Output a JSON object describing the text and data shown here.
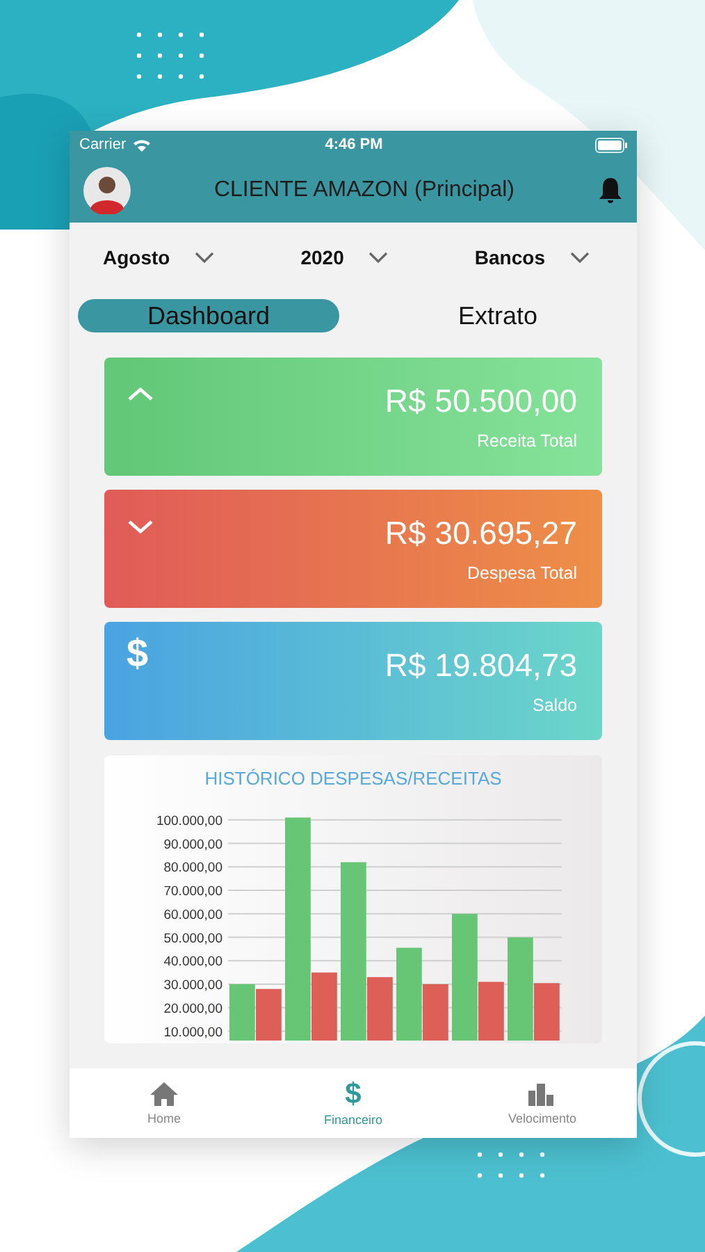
{
  "status_bar": {
    "carrier": "Carrier",
    "time": "4:46 PM"
  },
  "header": {
    "title": "CLIENTE AMAZON (Principal)"
  },
  "filters": [
    {
      "label": "Agosto"
    },
    {
      "label": "2020"
    },
    {
      "label": "Bancos"
    }
  ],
  "tabs": [
    {
      "label": "Dashboard",
      "selected": true
    },
    {
      "label": "Extrato",
      "selected": false
    }
  ],
  "cards": [
    {
      "kind": "income",
      "amount": "R$ 50.500,00",
      "label": "Receita Total"
    },
    {
      "kind": "expense",
      "amount": "R$ 30.695,27",
      "label": "Despesa Total"
    },
    {
      "kind": "balance",
      "icon": "$",
      "amount": "R$ 19.804,73",
      "label": "Saldo"
    }
  ],
  "chart": {
    "chart_data": {
      "type": "bar",
      "title": "HISTÓRICO DESPESAS/RECEITAS",
      "grid": true,
      "stacked": false,
      "ylim": [
        6000,
        102000
      ],
      "yticks": [
        {
          "value": 10000,
          "label": "10.000,00"
        },
        {
          "value": 20000,
          "label": "20.000,00"
        },
        {
          "value": 30000,
          "label": "30.000,00"
        },
        {
          "value": 40000,
          "label": "40.000,00"
        },
        {
          "value": 50000,
          "label": "50.000,00"
        },
        {
          "value": 60000,
          "label": "60.000,00"
        },
        {
          "value": 70000,
          "label": "70.000,00"
        },
        {
          "value": 80000,
          "label": "80.000,00"
        },
        {
          "value": 90000,
          "label": "90.000,00"
        },
        {
          "value": 100000,
          "label": "100.000,00"
        }
      ],
      "series": [
        {
          "color": "#66c676",
          "values": [
            30000,
            101000,
            82000,
            45500,
            60000,
            50000
          ]
        },
        {
          "color": "#dd5f57",
          "values": [
            28000,
            35000,
            33000,
            30000,
            31000,
            30500
          ]
        }
      ]
    }
  },
  "bottom_nav": [
    {
      "kind": "home",
      "label": "Home",
      "selected": false
    },
    {
      "kind": "money",
      "icon": "$",
      "label": "Financeiro",
      "selected": true
    },
    {
      "kind": "chart",
      "label": "Velocimento",
      "selected": false
    }
  ]
}
